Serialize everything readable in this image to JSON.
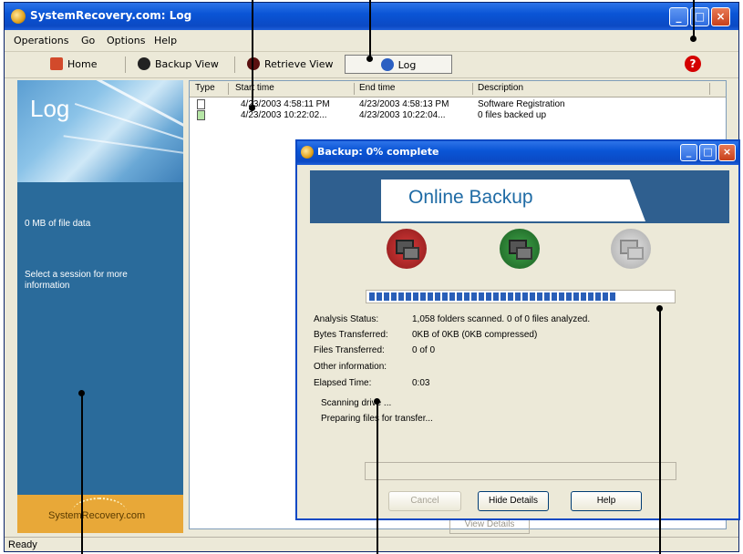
{
  "main_window": {
    "title": "SystemRecovery.com: Log",
    "menu": [
      "Operations",
      "Go",
      "Options",
      "Help"
    ],
    "toolbar": {
      "home": "Home",
      "backup_view": "Backup View",
      "retrieve_view": "Retrieve View",
      "log": "Log"
    },
    "left_pane": {
      "title": "Log",
      "data_info": "0 MB of file data",
      "hint": "Select a session for more information",
      "logo": "SystemRecovery.com"
    },
    "list": {
      "columns": [
        "Type",
        "Start time",
        "End time",
        "Description"
      ],
      "rows": [
        {
          "start": "4/23/2003 4:58:11 PM",
          "end": "4/23/2003 4:58:13 PM",
          "description": "Software Registration"
        },
        {
          "start": "4/23/2003 10:22:02...",
          "end": "4/23/2003 10:22:04...",
          "description": "0 files backed up"
        }
      ]
    },
    "view_details": "View Details",
    "status": "Ready"
  },
  "dialog": {
    "title": "Backup: 0% complete",
    "banner": "Online Backup",
    "progress_fraction": 0.82,
    "stats": [
      {
        "label": "Analysis Status:",
        "value": "1,058 folders scanned. 0 of 0 files analyzed."
      },
      {
        "label": "Bytes Transferred:",
        "value": "0KB of 0KB (0KB compressed)"
      },
      {
        "label": "Files Transferred:",
        "value": "0 of 0"
      },
      {
        "label": "Other information:",
        "value": ""
      },
      {
        "label": "Elapsed Time:",
        "value": "0:03"
      }
    ],
    "notes": [
      "Scanning drive ...",
      "Preparing files for transfer..."
    ],
    "buttons": {
      "cancel": "Cancel",
      "hide_details": "Hide Details",
      "help": "Help"
    }
  }
}
